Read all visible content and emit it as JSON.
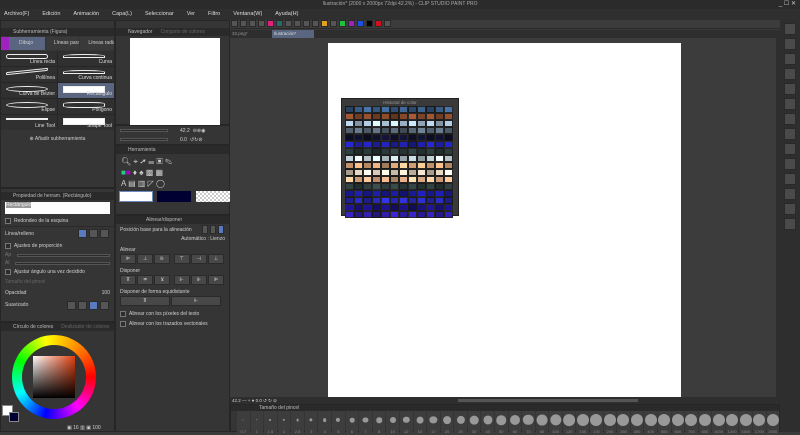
{
  "window": {
    "title": "Ilustración* (2000 x 2000px 72dpi 42.2%) - CLIP STUDIO PAINT PRO",
    "controls": "_ ☐ ✕"
  },
  "menu": [
    "Archivo(F)",
    "Edición",
    "Animación",
    "Capa(L)",
    "Seleccionar",
    "Ver",
    "Filtro",
    "Ventana(W)",
    "Ayuda(H)"
  ],
  "subtool": {
    "tab": "Subherramienta (Figura)",
    "groups": [
      "Dibujo directo",
      "Líneas paralelas",
      "Líneas radiales"
    ],
    "items": [
      "Línea recta",
      "Curva",
      "Polilínea",
      "Curva continua",
      "Curva de Bézier",
      "Rectángulo",
      "Elipse",
      "Polígono",
      "Line Tool",
      "Shape Tool"
    ],
    "selected": "Rectángulo",
    "add": "Añadir subherramienta"
  },
  "navigator": {
    "tabs": [
      "Navegador",
      "Conjunto de colores"
    ],
    "zoom": "42.2",
    "angle": "0.0"
  },
  "tool_panel": {
    "tab": "Herramienta"
  },
  "tool_property": {
    "tab": "Propiedad de herram. (Rectángulo)",
    "name": "Rectángulo",
    "rounded": "Redondeo de la esquina",
    "line_fill": "Línea/relleno",
    "aspect": "Ajustes de proporción",
    "ap": "Ap",
    "al": "Al",
    "fix_angle": "Ajustar ángulo una vez decidido",
    "brush_size": "Tamaño del pincel",
    "opacity": "Opacidad",
    "opacity_value": "100",
    "smoothing": "Suavizado"
  },
  "align": {
    "tab": "Alinear/disponer",
    "base": "Posición base para la alineación",
    "mode": "Automático : Lienzo",
    "alinear": "Alinear",
    "disponer": "Disponer",
    "equal": "Disponer de forma equidistante",
    "text_pixels": "Alinear con los píxeles del texto",
    "vector": "Alinear con los trazados vectoriales"
  },
  "color_panel": {
    "tabs": [
      "Círculo de colores",
      "Deslizador de colores"
    ],
    "h": "16",
    "v": "100",
    "main_color": "#ffffff",
    "sub_color": "#000033"
  },
  "doc_tabs": [
    "32.png*",
    "Ilustración*"
  ],
  "canvas": {
    "zoom": "42.2",
    "angle": "0.0"
  },
  "history": {
    "title": "Historial de color",
    "rows": [
      "#3a5f8a",
      "#8a4a2a",
      "#b8d4ec",
      "#5a6a7a",
      "#101030",
      "#2020b0",
      "#2a3a3a",
      "#c8d8e0",
      "#e8b080",
      "#f0e0c8",
      "#f0b890",
      "#304040",
      "#1a1aa0",
      "#2a2ac0",
      "#1a1080",
      "#3020b0"
    ]
  },
  "brush_panel": {
    "tab": "Tamaño del pincel",
    "sizes": [
      "0.7",
      "1",
      "1.5",
      "2",
      "2.5",
      "3",
      "4",
      "5",
      "6",
      "7",
      "8",
      "10",
      "12",
      "15",
      "17",
      "20",
      "25",
      "30",
      "40",
      "50",
      "60",
      "70",
      "80",
      "100",
      "120",
      "150",
      "170",
      "200",
      "250",
      "300",
      "400",
      "500",
      "600",
      "700",
      "800",
      "1000",
      "1200",
      "1500",
      "1700",
      "2000"
    ]
  }
}
